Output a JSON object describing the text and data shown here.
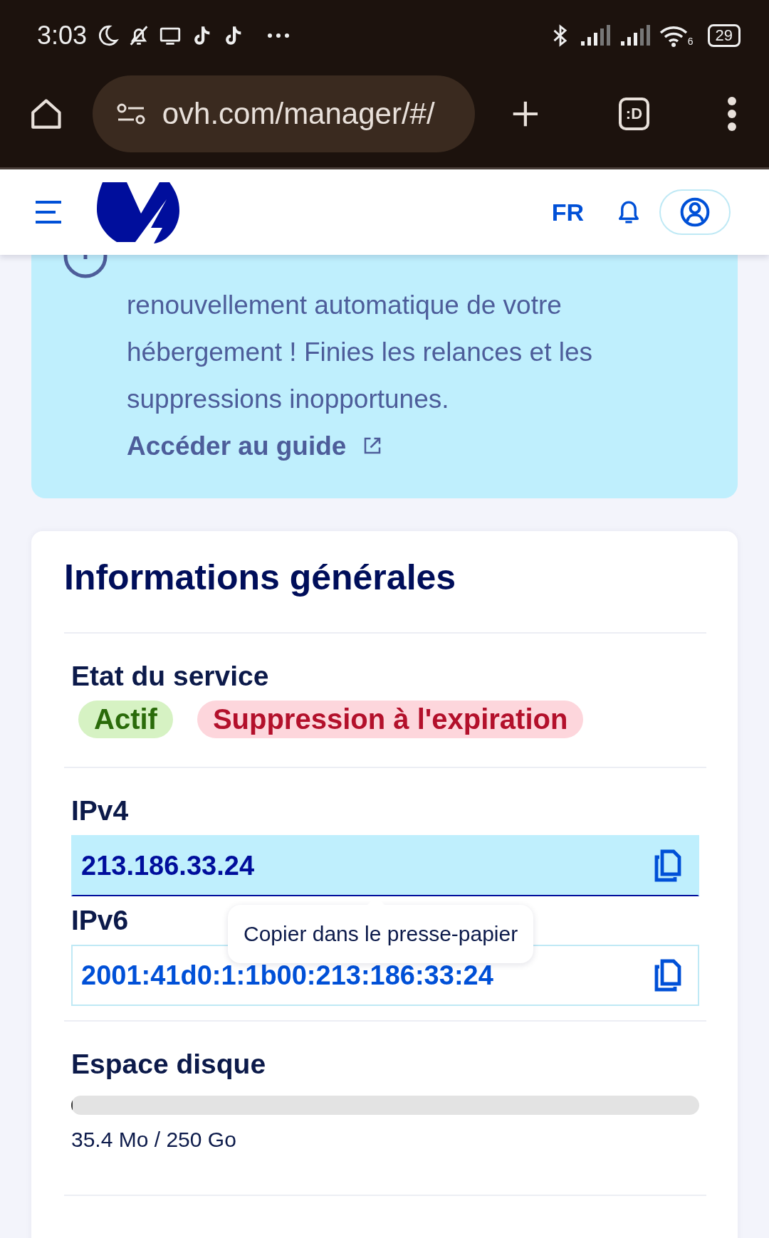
{
  "status_bar": {
    "time": "3:03",
    "wifi_label": "6",
    "battery": "29"
  },
  "browser": {
    "url": "ovh.com/manager/#/",
    "tab_label": ":D"
  },
  "header": {
    "language": "FR"
  },
  "banner": {
    "text": "renouvellement automatique de votre hébergement ! Finies les relances et les suppressions inopportunes.",
    "link": "Accéder au guide"
  },
  "card": {
    "title": "Informations générales",
    "service": {
      "label": "Etat du service",
      "badges": [
        {
          "text": "Actif",
          "color": "#2a6b0a"
        },
        {
          "text": "Suppression à l'expiration",
          "color": "#b3102b"
        }
      ]
    },
    "ip_fields": [
      {
        "label": "IPv4",
        "value": "213.186.33.24",
        "selected": true
      },
      {
        "label": "IPv6",
        "value": "2001:41d0:1:1b00:213:186:33:24",
        "selected": false
      }
    ],
    "tooltip": "Copier dans le presse-papier",
    "disk": {
      "label": "Espace disque",
      "level": 0.0001,
      "reading": "35.4 Mo / 250 Go"
    }
  }
}
